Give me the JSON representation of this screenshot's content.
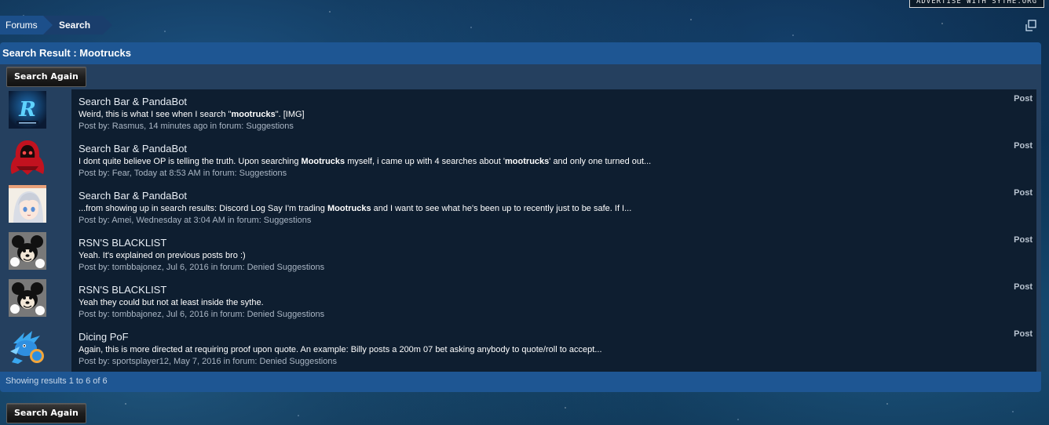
{
  "ad_link": {
    "label": "ADVERTISE WITH SYTHE.ORG"
  },
  "breadcrumb": {
    "items": [
      {
        "label": "Forums"
      },
      {
        "label": "Search"
      }
    ]
  },
  "panel": {
    "title": "Search Result : Mootrucks",
    "search_again_label": "Search Again",
    "footer_text": "Showing results 1 to 6 of 6"
  },
  "results": [
    {
      "avatar": "rasmus-logo-avatar",
      "title": "Search Bar & PandaBot",
      "snippet": [
        {
          "text": "Weird, this is what I see when I search \""
        },
        {
          "text": "mootrucks",
          "bold": true
        },
        {
          "text": "\". [IMG]"
        }
      ],
      "meta": "Post by: Rasmus, 14 minutes ago in forum: Suggestions",
      "type": "Post"
    },
    {
      "avatar": "red-hood-avatar",
      "title": "Search Bar & PandaBot",
      "snippet": [
        {
          "text": "I dont quite believe OP is telling the truth. Upon searching "
        },
        {
          "text": "Mootrucks",
          "bold": true
        },
        {
          "text": " myself, i came up with 4 searches about '"
        },
        {
          "text": "mootrucks",
          "bold": true
        },
        {
          "text": "' and only one turned out..."
        }
      ],
      "meta": "Post by: Fear, Today at 8:53 AM in forum: Suggestions",
      "type": "Post"
    },
    {
      "avatar": "anime-girl-avatar",
      "title": "Search Bar & PandaBot",
      "snippet": [
        {
          "text": "...from showing up in search results: Discord Log Say I'm trading "
        },
        {
          "text": "Mootrucks",
          "bold": true
        },
        {
          "text": " and I want to see what he's been up to recently just to be safe. If I..."
        }
      ],
      "meta": "Post by: Amei, Wednesday at 3:04 AM in forum: Suggestions",
      "type": "Post"
    },
    {
      "avatar": "cartoon-mouse-avatar",
      "title": "RSN'S BLACKLIST",
      "snippet": [
        {
          "text": "Yeah. It's explained on previous posts bro :)"
        }
      ],
      "meta": "Post by: tombbajonez, Jul 6, 2016 in forum: Denied Suggestions",
      "type": "Post"
    },
    {
      "avatar": "cartoon-mouse-avatar",
      "title": "RSN'S BLACKLIST",
      "snippet": [
        {
          "text": "Yeah they could but not at least inside the sythe."
        }
      ],
      "meta": "Post by: tombbajonez, Jul 6, 2016 in forum: Denied Suggestions",
      "type": "Post"
    },
    {
      "avatar": "blue-dragon-avatar",
      "title": "Dicing PoF",
      "snippet": [
        {
          "text": "Again, this is more directed at requiring proof upon quote. An example: Billy posts a 200m 07 bet asking anybody to quote/roll to accept..."
        }
      ],
      "meta": "Post by: sportsplayer12, May 7, 2016 in forum: Denied Suggestions",
      "type": "Post"
    }
  ],
  "colors": {
    "header_blue": "#1e5693",
    "row_bg": "#0e1e30",
    "avatar_col_bg": "#25405f",
    "breadcrumb_active": "#1a3e6c"
  }
}
